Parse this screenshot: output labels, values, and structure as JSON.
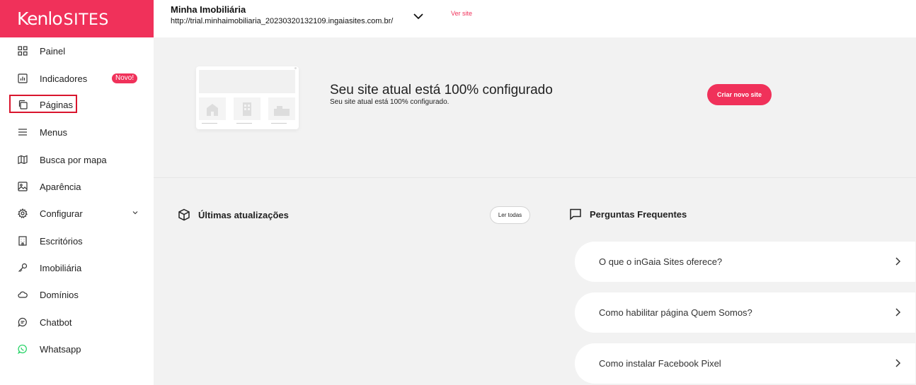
{
  "brand": {
    "logo_main": "Kenlo",
    "logo_suffix": "SITES",
    "color": "#f0315a"
  },
  "sidebar": {
    "items": [
      {
        "label": "Painel",
        "icon": "grid-icon"
      },
      {
        "label": "Indicadores",
        "icon": "bar-chart-icon",
        "badge": "Novo!"
      },
      {
        "label": "Páginas",
        "icon": "pages-icon"
      },
      {
        "label": "Menus",
        "icon": "menu-icon"
      },
      {
        "label": "Busca por mapa",
        "icon": "map-icon"
      },
      {
        "label": "Aparência",
        "icon": "image-icon"
      },
      {
        "label": "Configurar",
        "icon": "gear-icon"
      },
      {
        "label": "Escritórios",
        "icon": "building-icon"
      },
      {
        "label": "Imobiliária",
        "icon": "key-icon"
      },
      {
        "label": "Domínios",
        "icon": "cloud-icon"
      },
      {
        "label": "Chatbot",
        "icon": "chat-icon"
      },
      {
        "label": "Whatsapp",
        "icon": "whatsapp-icon"
      }
    ]
  },
  "topbar": {
    "site_name": "Minha Imobiliária",
    "site_url": "http://trial.minhaimobiliaria_20230320132109.ingaiasites.com.br/",
    "view_site": "Ver site"
  },
  "hero": {
    "title": "Seu site atual está 100% configurado",
    "subtitle": "Seu site atual está 100% configurado.",
    "button": "Criar novo site"
  },
  "updates": {
    "title": "Últimas atualizações",
    "read_all": "Ler todas"
  },
  "faq": {
    "title": "Perguntas Frequentes",
    "items": [
      "O que o inGaia Sites oferece?",
      "Como habilitar página Quem Somos?",
      "Como instalar Facebook Pixel"
    ]
  },
  "colors": {
    "accent": "#f0315a",
    "whatsapp": "#25d366",
    "highlight": "#d9152d"
  }
}
